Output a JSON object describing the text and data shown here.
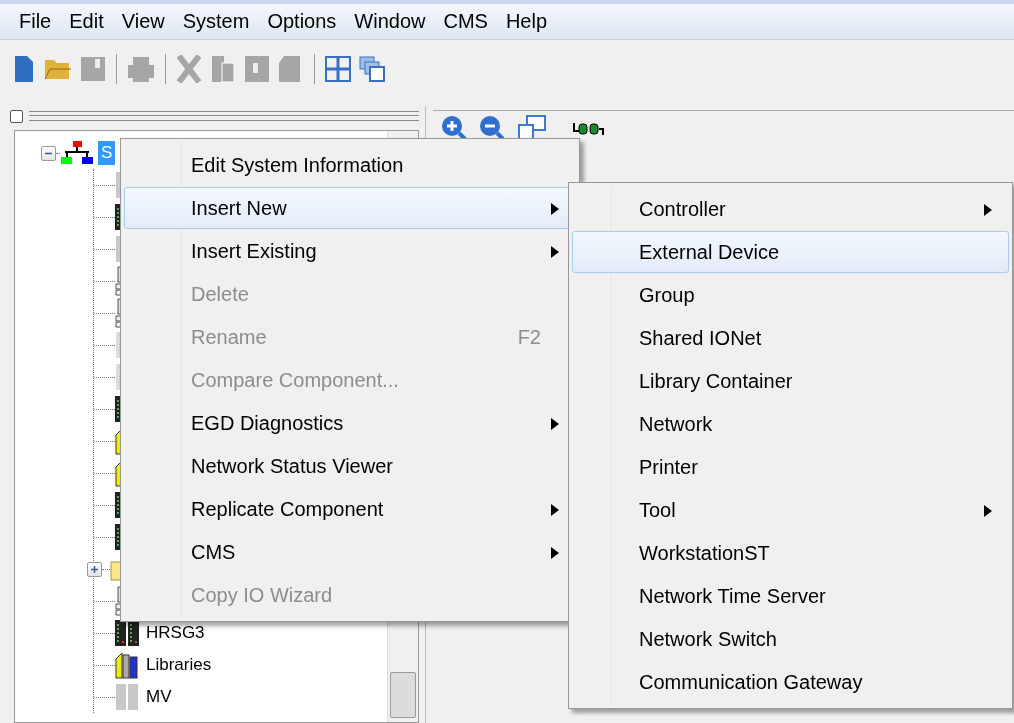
{
  "menu_bar": [
    "File",
    "Edit",
    "View",
    "System",
    "Options",
    "Window",
    "CMS",
    "Help"
  ],
  "tree": {
    "label": "S",
    "kind": "system",
    "expanded": true,
    "selected": true,
    "children": [
      {
        "kind": "blank"
      },
      {
        "kind": "controller"
      },
      {
        "kind": "blank"
      },
      {
        "kind": "workstation"
      },
      {
        "kind": "workstation"
      },
      {
        "kind": "io"
      },
      {
        "kind": "io"
      },
      {
        "kind": "controller"
      },
      {
        "kind": "library"
      },
      {
        "kind": "library"
      },
      {
        "kind": "controller"
      },
      {
        "kind": "controller"
      },
      {
        "kind": "folder",
        "expanded": false
      },
      {
        "kind": "workstation"
      },
      {
        "kind": "controller",
        "label": "HRSG3"
      },
      {
        "kind": "library",
        "label": "Libraries"
      },
      {
        "kind": "blank",
        "label": "MV"
      }
    ]
  },
  "context_menu": [
    {
      "label": "Edit System Information",
      "disabled": false,
      "submenu": false,
      "selected": false
    },
    {
      "label": "Insert New",
      "disabled": false,
      "submenu": true,
      "selected": true
    },
    {
      "label": "Insert Existing",
      "disabled": false,
      "submenu": true,
      "selected": false
    },
    {
      "label": "Delete",
      "disabled": true,
      "submenu": false,
      "selected": false
    },
    {
      "label": "Rename",
      "shortcut": "F2",
      "disabled": true,
      "submenu": false,
      "selected": false
    },
    {
      "label": "Compare Component...",
      "disabled": true,
      "submenu": false,
      "selected": false
    },
    {
      "label": "EGD Diagnostics",
      "disabled": false,
      "submenu": true,
      "selected": false
    },
    {
      "label": "Network Status Viewer",
      "disabled": false,
      "submenu": false,
      "selected": false
    },
    {
      "label": "Replicate Component",
      "disabled": false,
      "submenu": true,
      "selected": false
    },
    {
      "label": "CMS",
      "disabled": false,
      "submenu": true,
      "selected": false
    },
    {
      "label": "Copy IO Wizard",
      "disabled": true,
      "submenu": false,
      "selected": false
    }
  ],
  "submenu": [
    {
      "label": "Controller",
      "disabled": false,
      "submenu": true,
      "selected": false
    },
    {
      "label": "External Device",
      "disabled": false,
      "submenu": false,
      "selected": true
    },
    {
      "label": "Group",
      "disabled": false,
      "submenu": false,
      "selected": false
    },
    {
      "label": "Shared IONet",
      "disabled": false,
      "submenu": false,
      "selected": false
    },
    {
      "label": "Library Container",
      "disabled": false,
      "submenu": false,
      "selected": false
    },
    {
      "label": "Network",
      "disabled": false,
      "submenu": false,
      "selected": false
    },
    {
      "label": "Printer",
      "disabled": false,
      "submenu": false,
      "selected": false
    },
    {
      "label": "Tool",
      "disabled": false,
      "submenu": true,
      "selected": false
    },
    {
      "label": "WorkstationST",
      "disabled": false,
      "submenu": false,
      "selected": false
    },
    {
      "label": "Network Time Server",
      "disabled": false,
      "submenu": false,
      "selected": false
    },
    {
      "label": "Network Switch",
      "disabled": false,
      "submenu": false,
      "selected": false
    },
    {
      "label": "Communication Gateway",
      "disabled": false,
      "submenu": false,
      "selected": false
    }
  ]
}
